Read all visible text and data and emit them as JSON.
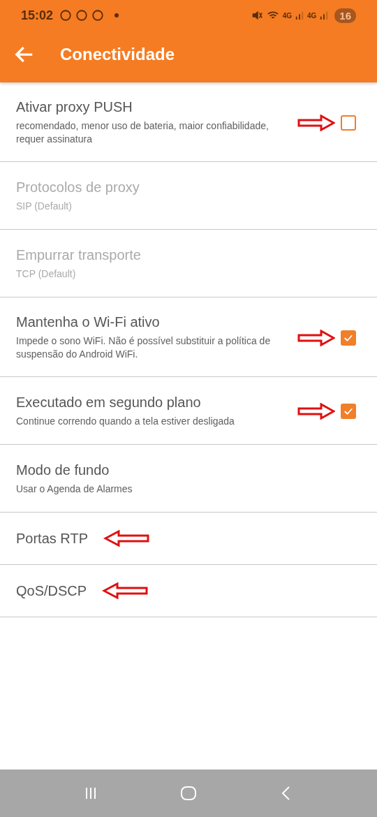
{
  "status_bar": {
    "time": "15:02",
    "network_labels": [
      "4G",
      "4G"
    ],
    "battery": "16"
  },
  "app_bar": {
    "title": "Conectividade"
  },
  "settings": [
    {
      "title": "Ativar proxy PUSH",
      "summary": "recomendado, menor uso de bateria, maior confiabilidade, requer assinatura",
      "kind": "checkbox",
      "checked": false,
      "disabled": false,
      "arrow": true
    },
    {
      "title": "Protocolos de proxy",
      "summary": "SIP (Default)",
      "kind": "plain",
      "disabled": true,
      "arrow": false
    },
    {
      "title": "Empurrar transporte",
      "summary": "TCP (Default)",
      "kind": "plain",
      "disabled": true,
      "arrow": false
    },
    {
      "title": "Mantenha o Wi-Fi ativo",
      "summary": "Impede o sono WiFi. Não é possível substituir a política de suspensão do Android WiFi.",
      "kind": "checkbox",
      "checked": true,
      "disabled": false,
      "arrow": true
    },
    {
      "title": "Executado em segundo plano",
      "summary": "Continue correndo quando a tela estiver desligada",
      "kind": "checkbox",
      "checked": true,
      "disabled": false,
      "arrow": true
    },
    {
      "title": "Modo de fundo",
      "summary": "Usar o Agenda de Alarmes",
      "kind": "plain",
      "disabled": false,
      "arrow": false
    },
    {
      "title": "Portas RTP",
      "kind": "plain",
      "disabled": false,
      "arrow": true
    },
    {
      "title": "QoS/DSCP",
      "kind": "plain",
      "disabled": false,
      "arrow": true
    }
  ]
}
